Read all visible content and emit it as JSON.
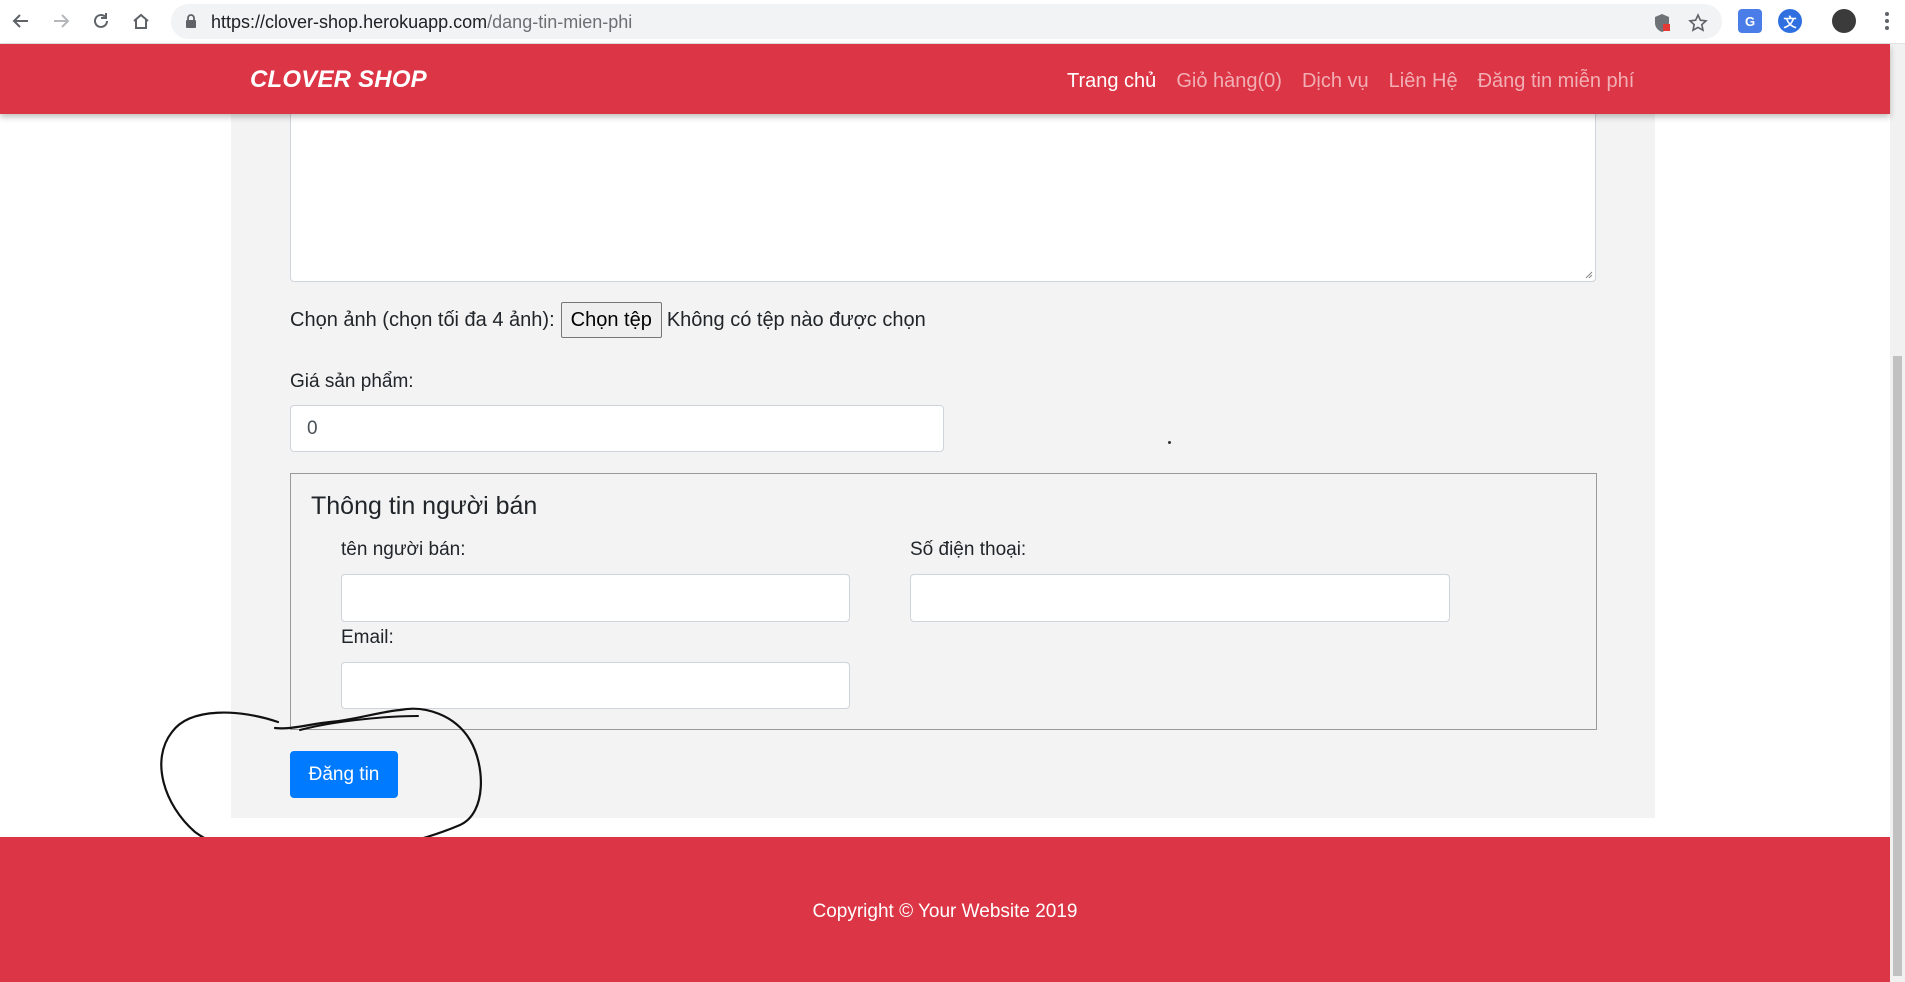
{
  "browser": {
    "url_host": "https://clover-shop.herokuapp.com",
    "url_path": "/dang-tin-mien-phi",
    "icons": [
      "back-icon",
      "forward-icon",
      "reload-icon",
      "home-icon",
      "lock-icon",
      "shield-icon",
      "star-icon",
      "translate-icon",
      "extension-icon",
      "profile-avatar",
      "menu-dots-icon"
    ]
  },
  "navbar": {
    "brand": "CLOVER SHOP",
    "links": [
      {
        "label": "Trang chủ",
        "active": true
      },
      {
        "label": "Giỏ hàng(0)",
        "active": false
      },
      {
        "label": "Dịch vụ",
        "active": false
      },
      {
        "label": "Liên Hệ",
        "active": false
      },
      {
        "label": "Đăng tin miễn phí",
        "active": false
      }
    ]
  },
  "form": {
    "image_label": "Chọn ảnh (chọn tối đa 4 ảnh):",
    "file_button": "Chọn tệp",
    "file_status": "Không có tệp nào được chọn",
    "price_label": "Giá sản phẩm:",
    "price_value": "0",
    "seller_legend": "Thông tin người bán",
    "seller_name_label": "tên người bán:",
    "phone_label": "Số điện thoại:",
    "email_label": "Email:",
    "submit_label": "Đăng tin"
  },
  "footer": {
    "copyright": "Copyright © Your Website 2019"
  },
  "colors": {
    "brand_red": "#dc3545",
    "primary_blue": "#007bff",
    "panel_gray": "#f3f3f3"
  }
}
